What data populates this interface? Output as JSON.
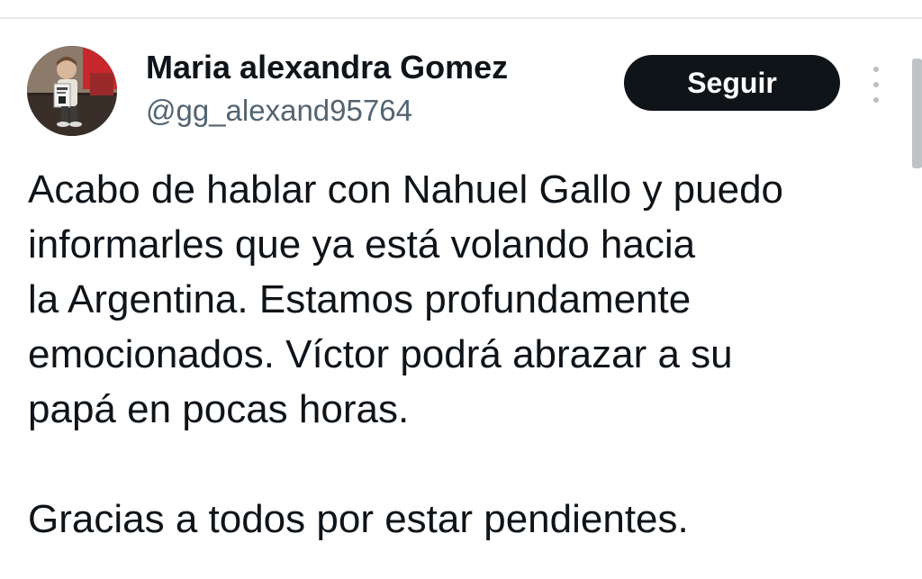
{
  "user": {
    "display_name": "Maria alexandra Gomez",
    "handle": "@gg_alexand95764"
  },
  "follow_button": {
    "label": "Seguir"
  },
  "more_menu": {
    "icon": "vertical-ellipsis-icon"
  },
  "tweet": {
    "lines": [
      "Acabo de hablar con Nahuel Gallo y puedo",
      "informarles que ya está volando hacia",
      "la Argentina. Estamos profundamente",
      "emocionados. Víctor podrá abrazar a su",
      "papá en pocas horas."
    ],
    "closing": "Gracias a todos por estar pendientes."
  },
  "colors": {
    "text": "#0f1419",
    "secondary": "#536471",
    "button_bg": "#0f1419",
    "button_text": "#ffffff",
    "divider": "#e7e9ea"
  }
}
